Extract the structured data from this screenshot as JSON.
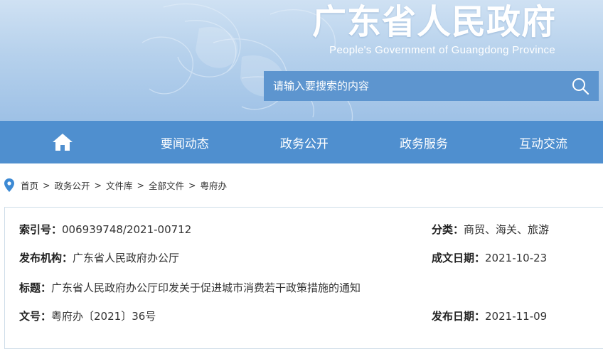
{
  "header": {
    "title": "广东省人民政府",
    "subtitle": "People's Government of Guangdong Province",
    "colors": {
      "header_bg": "#b6d1ec",
      "search_bg": "#5d95cf",
      "nav_bg": "#4f8fcf"
    }
  },
  "search": {
    "placeholder": "请输入要搜索的内容",
    "icon": "search-icon"
  },
  "nav": {
    "home_icon": "home-icon",
    "items": [
      {
        "label": "要闻动态"
      },
      {
        "label": "政务公开"
      },
      {
        "label": "政务服务"
      },
      {
        "label": "互动交流"
      }
    ]
  },
  "breadcrumb": {
    "icon": "location-pin-icon",
    "items": [
      "首页",
      "政务公开",
      "文件库",
      "全部文件",
      "粤府办"
    ],
    "separator": ">"
  },
  "doc_info": {
    "index_no": {
      "label": "索引号：",
      "value": "006939748/2021-00712"
    },
    "category": {
      "label": "分类：",
      "value": "商贸、海关、旅游"
    },
    "publisher": {
      "label": "发布机构：",
      "value": "广东省人民政府办公厅"
    },
    "written_date": {
      "label": "成文日期：",
      "value": "2021-10-23"
    },
    "title": {
      "label": "标题：",
      "value": "广东省人民政府办公厅印发关于促进城市消费若干政策措施的通知"
    },
    "doc_no": {
      "label": "文号：",
      "value": "粤府办〔2021〕36号"
    },
    "publish_date": {
      "label": "发布日期：",
      "value": "2021-11-09"
    }
  }
}
